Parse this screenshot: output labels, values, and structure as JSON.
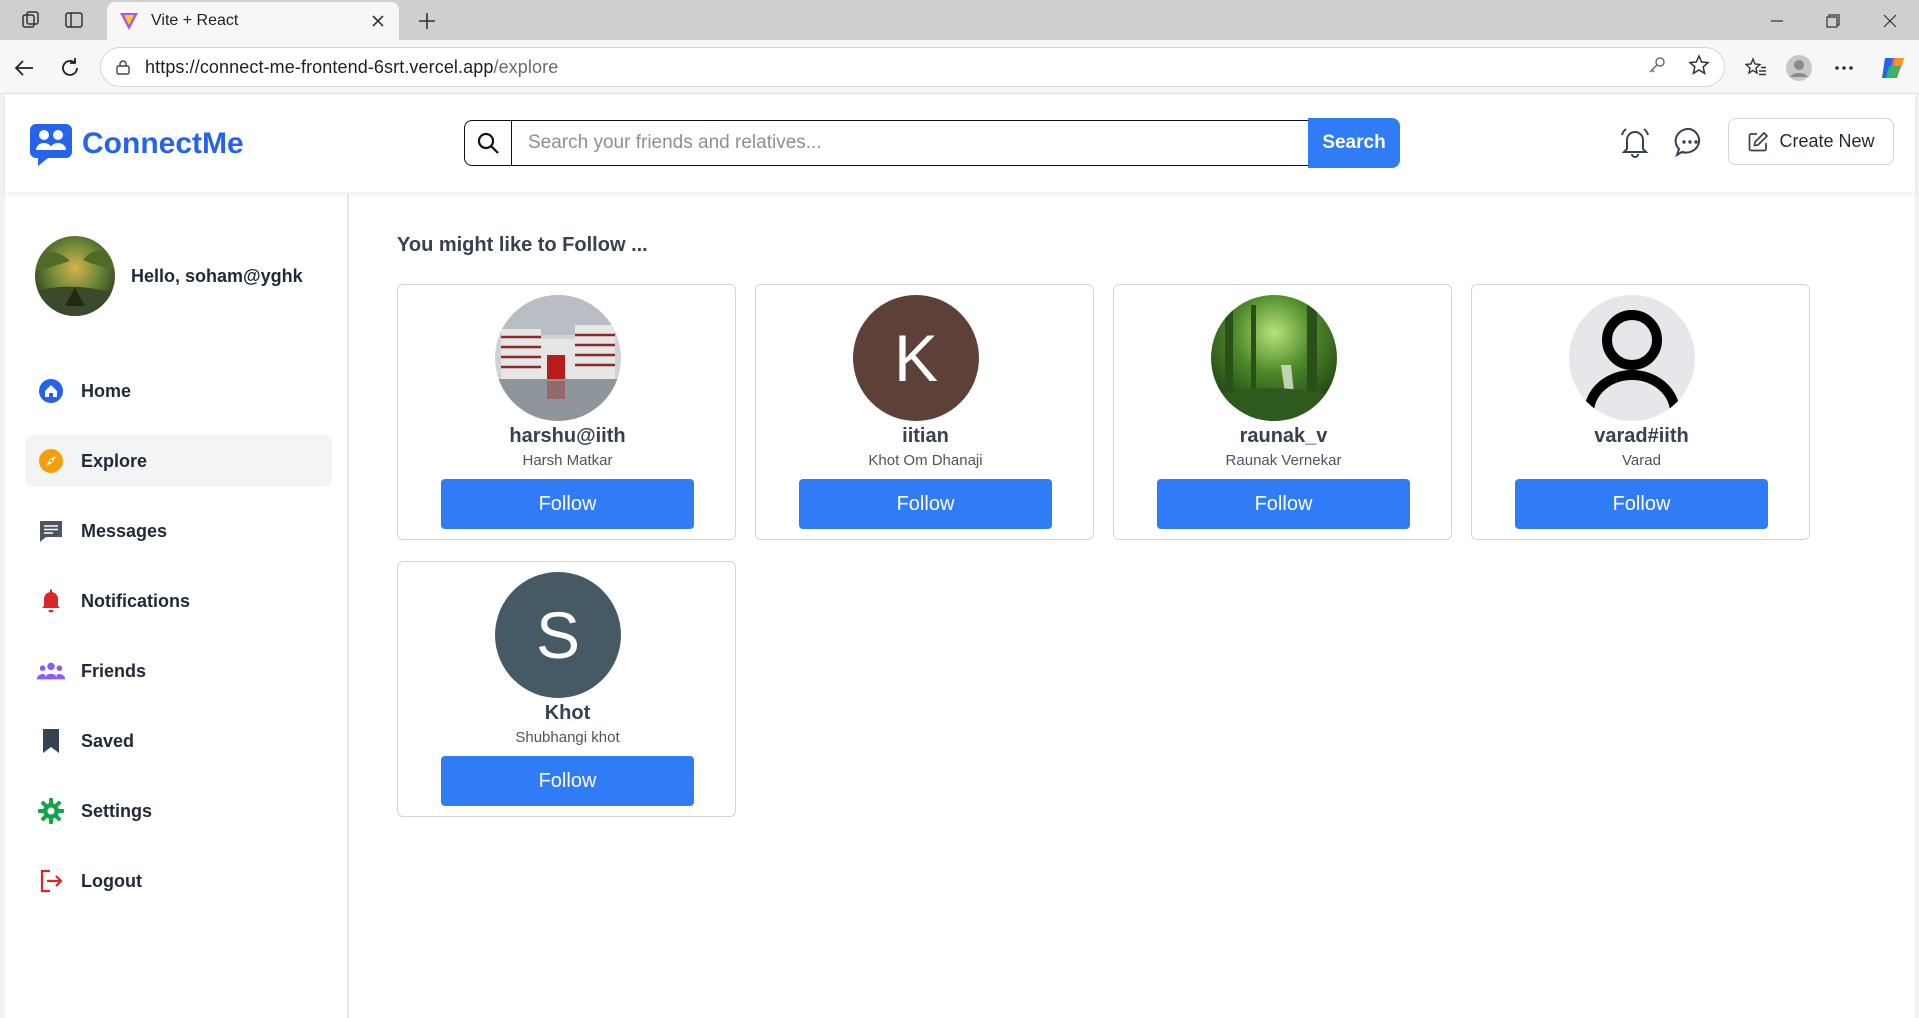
{
  "browser": {
    "tab_title": "Vite + React",
    "url_host": "https://connect-me-frontend-6srt.vercel.app",
    "url_path": "/explore"
  },
  "header": {
    "brand": "ConnectMe",
    "search_placeholder": "Search your friends and relatives...",
    "search_button": "Search",
    "create_new": "Create New"
  },
  "sidebar": {
    "greeting": "Hello, soham@yghk",
    "items": [
      {
        "label": "Home",
        "icon": "home-icon",
        "color": "#2563eb"
      },
      {
        "label": "Explore",
        "icon": "compass-icon",
        "color": "#f59e0b"
      },
      {
        "label": "Messages",
        "icon": "message-icon",
        "color": "#4b5563"
      },
      {
        "label": "Notifications",
        "icon": "bell-icon",
        "color": "#dc2626"
      },
      {
        "label": "Friends",
        "icon": "users-icon",
        "color": "#8b5cf6"
      },
      {
        "label": "Saved",
        "icon": "bookmark-icon",
        "color": "#374151"
      },
      {
        "label": "Settings",
        "icon": "gear-icon",
        "color": "#16a34a"
      },
      {
        "label": "Logout",
        "icon": "logout-icon",
        "color": "#dc2626"
      }
    ]
  },
  "main": {
    "title": "You might like to Follow ...",
    "follow_label": "Follow",
    "suggestions": [
      {
        "username": "harshu@iith",
        "name": "Harsh Matkar"
      },
      {
        "username": "iitian",
        "name": "Khot Om Dhanaji",
        "initial": "K",
        "color": "#5d4037"
      },
      {
        "username": "raunak_v",
        "name": "Raunak Vernekar"
      },
      {
        "username": "varad#iith",
        "name": "Varad"
      },
      {
        "username": "Khot",
        "name": "Shubhangi khot",
        "initial": "S",
        "color": "#455a64"
      }
    ]
  }
}
